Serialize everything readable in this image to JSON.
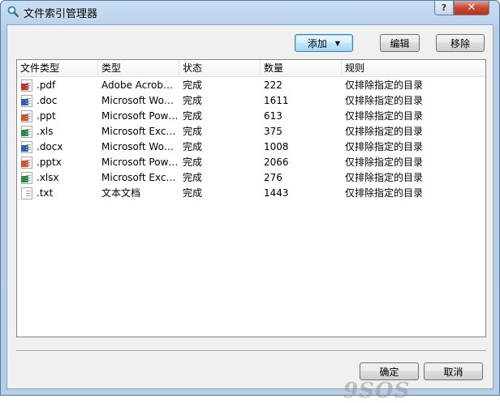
{
  "window": {
    "title": "文件索引管理器",
    "help_label": "?",
    "close_label": "✕"
  },
  "toolbar": {
    "add_label": "添加",
    "add_arrow": "▼",
    "edit_label": "编辑",
    "remove_label": "移除"
  },
  "table": {
    "columns": [
      "文件类型",
      "类型",
      "状态",
      "数量",
      "规则"
    ],
    "rows": [
      {
        "ext": ".pdf",
        "type": "Adobe Acrob…",
        "status": "完成",
        "count": "222",
        "rule": "仅排除指定的目录",
        "icon": "pdf-file-icon",
        "icon_color": "#d22b1f"
      },
      {
        "ext": ".doc",
        "type": "Microsoft Wo…",
        "status": "完成",
        "count": "1611",
        "rule": "仅排除指定的目录",
        "icon": "doc-file-icon",
        "icon_color": "#2b5fb8"
      },
      {
        "ext": ".ppt",
        "type": "Microsoft Pow…",
        "status": "完成",
        "count": "613",
        "rule": "仅排除指定的目录",
        "icon": "ppt-file-icon",
        "icon_color": "#d0552a"
      },
      {
        "ext": ".xls",
        "type": "Microsoft Exc…",
        "status": "完成",
        "count": "375",
        "rule": "仅排除指定的目录",
        "icon": "xls-file-icon",
        "icon_color": "#2e8b3e"
      },
      {
        "ext": ".docx",
        "type": "Microsoft Wo…",
        "status": "完成",
        "count": "1008",
        "rule": "仅排除指定的目录",
        "icon": "docx-file-icon",
        "icon_color": "#2b5fb8"
      },
      {
        "ext": ".pptx",
        "type": "Microsoft Pow…",
        "status": "完成",
        "count": "2066",
        "rule": "仅排除指定的目录",
        "icon": "pptx-file-icon",
        "icon_color": "#d0552a"
      },
      {
        "ext": ".xlsx",
        "type": "Microsoft Exc…",
        "status": "完成",
        "count": "276",
        "rule": "仅排除指定的目录",
        "icon": "xlsx-file-icon",
        "icon_color": "#2e8b3e"
      },
      {
        "ext": ".txt",
        "type": "文本文档",
        "status": "完成",
        "count": "1443",
        "rule": "仅排除指定的目录",
        "icon": "txt-file-icon",
        "icon_color": "#ffffff"
      }
    ]
  },
  "footer": {
    "ok_label": "确定",
    "cancel_label": "取消"
  },
  "watermark": "9SOS"
}
